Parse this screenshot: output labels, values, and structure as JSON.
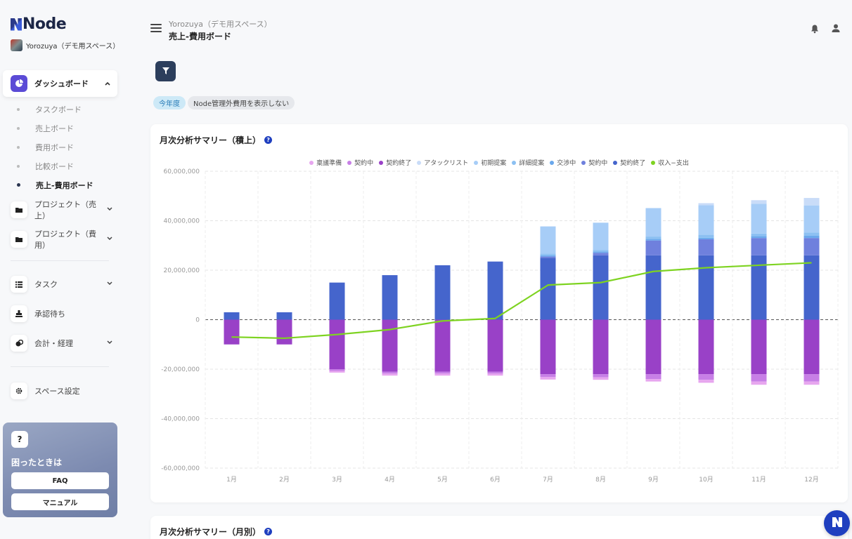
{
  "sidebar": {
    "logo": "Node",
    "workspace": "Yorozuya（デモ用スペース）",
    "dashboard_label": "ダッシュボード",
    "dashboard_sub": [
      "タスクボード",
      "売上ボード",
      "費用ボード",
      "比較ボード",
      "売上-費用ボード"
    ],
    "active_sub": "売上-費用ボード",
    "project_sales": "プロジェクト（売上）",
    "project_cost": "プロジェクト（費用）",
    "task": "タスク",
    "approval": "承認待ち",
    "accounting": "会計・経理",
    "space_settings": "スペース設定",
    "help": {
      "title": "困ったときは",
      "faq": "FAQ",
      "manual": "マニュアル"
    }
  },
  "header": {
    "breadcrumb": "Yorozuya（デモ用スペース）",
    "title": "売上-費用ボード"
  },
  "filters": {
    "year_chip": "今年度",
    "node_chip": "Node管理外費用を表示しない"
  },
  "colors": {
    "brand": "#1f3fbf",
    "sidebar_active": "#5b4bd6",
    "filter_btn": "#2c3e5c",
    "line": "#7ed321"
  },
  "chart_card": {
    "title": "月次分析サマリー（積上）"
  },
  "chart_card2": {
    "title": "月次分析サマリー（月別）"
  },
  "chart_data": {
    "type": "bar",
    "stacked": true,
    "categories": [
      "1月",
      "2月",
      "3月",
      "4月",
      "5月",
      "6月",
      "7月",
      "8月",
      "9月",
      "10月",
      "11月",
      "12月"
    ],
    "ylim": [
      -60000000,
      60000000
    ],
    "yticks": [
      "60,000,000",
      "40,000,000",
      "20,000,000",
      "0",
      "-20,000,000",
      "-40,000,000",
      "-60,000,000"
    ],
    "grid": true,
    "legend_position": "top",
    "series": [
      {
        "name": "稟議準備",
        "color": "#e7a6ef",
        "values": [
          0,
          0,
          -700000,
          -800000,
          -800000,
          -800000,
          -1000000,
          -1000000,
          -1000000,
          -1200000,
          -1300000,
          -1300000
        ]
      },
      {
        "name": "契約中",
        "color": "#c77fe6",
        "values": [
          0,
          0,
          -700000,
          -800000,
          -800000,
          -800000,
          -1200000,
          -1300000,
          -2000000,
          -2300000,
          -3000000,
          -3000000
        ]
      },
      {
        "name": "契約終了",
        "color": "#9941c7",
        "values": [
          -10000000,
          -10000000,
          -20000000,
          -21000000,
          -21000000,
          -21000000,
          -22000000,
          -22000000,
          -22000000,
          -22000000,
          -22000000,
          -22000000
        ]
      },
      {
        "name": "アタックリスト",
        "color": "#c9dcf8",
        "values": [
          0,
          0,
          0,
          0,
          0,
          0,
          0,
          0,
          0,
          800000,
          1500000,
          3000000
        ]
      },
      {
        "name": "初期提案",
        "color": "#a7cdf7",
        "values": [
          0,
          0,
          0,
          0,
          0,
          0,
          11000000,
          11000000,
          11500000,
          12000000,
          12000000,
          11000000
        ]
      },
      {
        "name": "詳細提案",
        "color": "#8cc0f2",
        "values": [
          0,
          0,
          0,
          0,
          0,
          0,
          700000,
          700000,
          1000000,
          1200000,
          1000000,
          1200000
        ]
      },
      {
        "name": "交渉中",
        "color": "#6aa8ec",
        "values": [
          0,
          0,
          0,
          0,
          0,
          0,
          500000,
          500000,
          600000,
          600000,
          800000,
          1000000
        ]
      },
      {
        "name": "契約中",
        "color": "#6f80dd",
        "values": [
          0,
          0,
          0,
          0,
          0,
          0,
          500000,
          1000000,
          6000000,
          6500000,
          7000000,
          7000000
        ]
      },
      {
        "name": "契約終了",
        "color": "#4565cc",
        "values": [
          3000000,
          3000000,
          15000000,
          18000000,
          22000000,
          23500000,
          25000000,
          26000000,
          26000000,
          26000000,
          26000000,
          26000000
        ]
      }
    ],
    "line": {
      "name": "収入−支出",
      "color": "#7ed321",
      "values": [
        -7000000,
        -7500000,
        -6000000,
        -4000000,
        -500000,
        500000,
        14000000,
        15000000,
        19500000,
        21000000,
        22000000,
        23000000
      ]
    }
  }
}
